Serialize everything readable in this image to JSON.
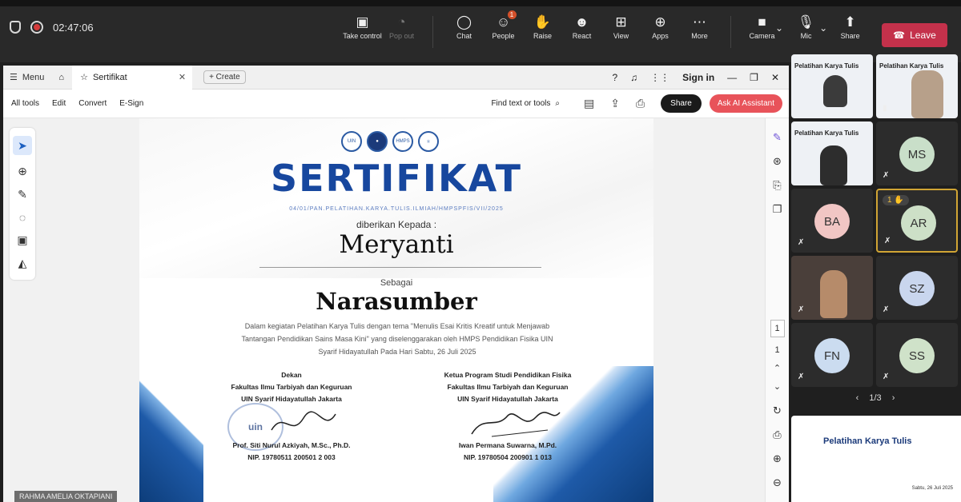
{
  "meeting": {
    "timer": "02:47:06",
    "tools": [
      {
        "label": "Take control",
        "icon": "take-control-icon",
        "glyph": "⬚"
      },
      {
        "label": "Pop out",
        "icon": "pop-out-icon",
        "glyph": "⊕",
        "disabled": true
      },
      {
        "label": "Chat",
        "icon": "chat-icon",
        "glyph": "💬"
      },
      {
        "label": "People",
        "icon": "people-icon",
        "glyph": "👥",
        "badge": "1"
      },
      {
        "label": "Raise",
        "icon": "raise-hand-icon",
        "glyph": "✋"
      },
      {
        "label": "React",
        "icon": "react-icon",
        "glyph": "☺"
      },
      {
        "label": "View",
        "icon": "view-icon",
        "glyph": "⊞"
      },
      {
        "label": "Apps",
        "icon": "apps-icon",
        "glyph": "⊕"
      },
      {
        "label": "More",
        "icon": "more-icon",
        "glyph": "⋯"
      }
    ],
    "camera_label": "Camera",
    "mic_label": "Mic",
    "share_label": "Share",
    "leave_label": "Leave",
    "leave_color": "#c4314b"
  },
  "acrobat": {
    "menu_label": "Menu",
    "tab_title": "Sertifikat",
    "create_label": "+ Create",
    "sign_in": "Sign in",
    "toolbar": [
      "All tools",
      "Edit",
      "Convert",
      "E-Sign"
    ],
    "find_label": "Find text or tools",
    "share_label": "Share",
    "ai_label": "Ask AI Assistant",
    "page_current": "1",
    "page_total": "1"
  },
  "certificate": {
    "title": "SERTIFIKAT",
    "code": "04/01/PAN.PELATIHAN.KARYA.TULIS.ILMIAH/HMPSPFIS/VII/2025",
    "given_to": "diberikan Kepada :",
    "recipient": "Meryanti",
    "as_label": "Sebagai",
    "role": "Narasumber",
    "description": "Dalam kegiatan Pelatihan Karya Tulis dengan tema \"Menulis Esai Kritis Kreatif untuk Menjawab Tantangan Pendidikan Sains Masa Kini\" yang diselenggarakan oleh HMPS Pendidikan Fisika UIN Syarif Hidayatullah Pada Hari Sabtu, 26 Juli 2025",
    "left_signer": {
      "position": "Dekan",
      "faculty": "Fakultas Ilmu Tarbiyah dan Keguruan",
      "univ": "UIN Syarif Hidayatullah Jakarta",
      "name": "Prof. Siti Nurul Azkiyah, M.Sc., Ph.D.",
      "nip": "NIP. 19780511 200501 2 003"
    },
    "right_signer": {
      "position": "Ketua Program Studi Pendidikan Fisika",
      "faculty": "Fakultas Ilmu Tarbiyah dan Keguruan",
      "univ": "UIN Syarif Hidayatullah Jakarta",
      "name": "Iwan Permana Suwarna, M.Pd.",
      "nip": "NIP. 19780504 200901 1 013"
    },
    "stamp_text": "uin"
  },
  "presenter_name": "RAHMA AMELIA OKTAPIANI",
  "participants": [
    {
      "initials": "MS",
      "color": "#c9dfc9"
    },
    {
      "initials": "BA",
      "color": "#f1c6c4"
    },
    {
      "initials": "AR",
      "color": "#cde0c7",
      "hand": "1",
      "active": true
    },
    {
      "initials": "SZ",
      "color": "#c9d6ee"
    },
    {
      "initials": "FN",
      "color": "#cbdcf0"
    },
    {
      "initials": "SS",
      "color": "#cfe2c9"
    }
  ],
  "video_tiles": [
    {
      "title": "Pelatihan Karya Tulis"
    },
    {
      "title": "Pelatihan Karya Tulis"
    },
    {
      "title": "Pelatihan Karya Tulis"
    }
  ],
  "gallery_page": "1/3",
  "preview": {
    "title": "Pelatihan Karya Tulis",
    "date": "Sabtu, 26 Juli 2025"
  }
}
